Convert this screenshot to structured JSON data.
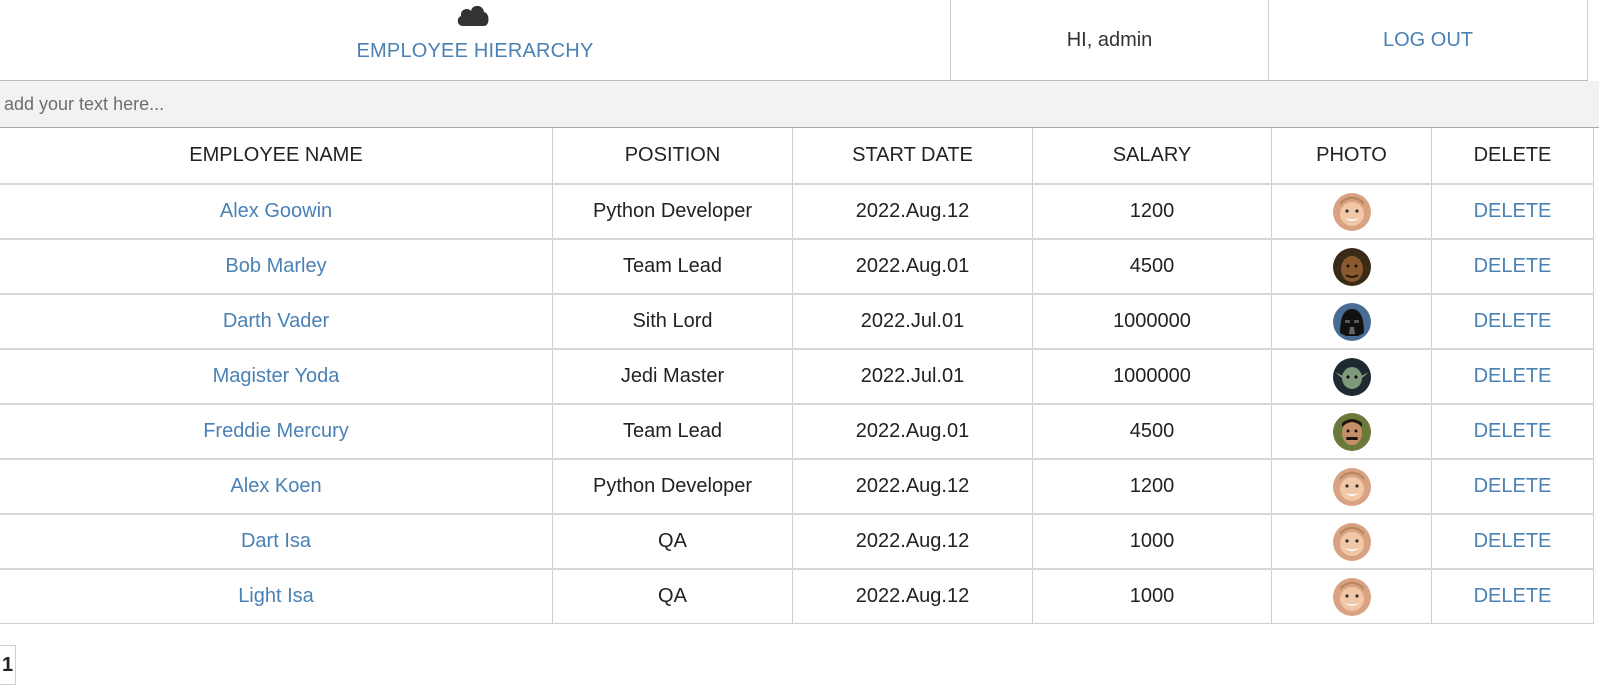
{
  "header": {
    "brand_label": "EMPLOYEE HIERARCHY",
    "brand_icon": "cloud-icon",
    "greeting": "HI, admin",
    "logout_label": "LOG OUT"
  },
  "search": {
    "placeholder": "add your text here...",
    "value": ""
  },
  "table": {
    "columns": [
      "EMPLOYEE NAME",
      "POSITION",
      "START DATE",
      "SALARY",
      "PHOTO",
      "DELETE"
    ],
    "rows": [
      {
        "name": "Alex Goowin",
        "position": "Python Developer",
        "start_date": "2022.Aug.12",
        "salary": "1200",
        "photo": "smiling-man-photo",
        "delete": "DELETE"
      },
      {
        "name": "Bob Marley",
        "position": "Team Lead",
        "start_date": "2022.Aug.01",
        "salary": "4500",
        "photo": "bob-marley-photo",
        "delete": "DELETE"
      },
      {
        "name": "Darth Vader",
        "position": "Sith Lord",
        "start_date": "2022.Jul.01",
        "salary": "1000000",
        "photo": "darth-vader-photo",
        "delete": "DELETE"
      },
      {
        "name": "Magister Yoda",
        "position": "Jedi Master",
        "start_date": "2022.Jul.01",
        "salary": "1000000",
        "photo": "yoda-photo",
        "delete": "DELETE"
      },
      {
        "name": "Freddie Mercury",
        "position": "Team Lead",
        "start_date": "2022.Aug.01",
        "salary": "4500",
        "photo": "freddie-mercury-photo",
        "delete": "DELETE"
      },
      {
        "name": "Alex Koen",
        "position": "Python Developer",
        "start_date": "2022.Aug.12",
        "salary": "1200",
        "photo": "smiling-man-photo",
        "delete": "DELETE"
      },
      {
        "name": "Dart Isa",
        "position": "QA",
        "start_date": "2022.Aug.12",
        "salary": "1000",
        "photo": "smiling-man-photo",
        "delete": "DELETE"
      },
      {
        "name": "Light Isa",
        "position": "QA",
        "start_date": "2022.Aug.12",
        "salary": "1000",
        "photo": "smiling-man-photo",
        "delete": "DELETE"
      }
    ]
  },
  "pagination": {
    "current_page": "1"
  },
  "colors": {
    "link": "#4a81b5",
    "search_bg": "#f2f2f2",
    "border": "#cfcfcf"
  }
}
